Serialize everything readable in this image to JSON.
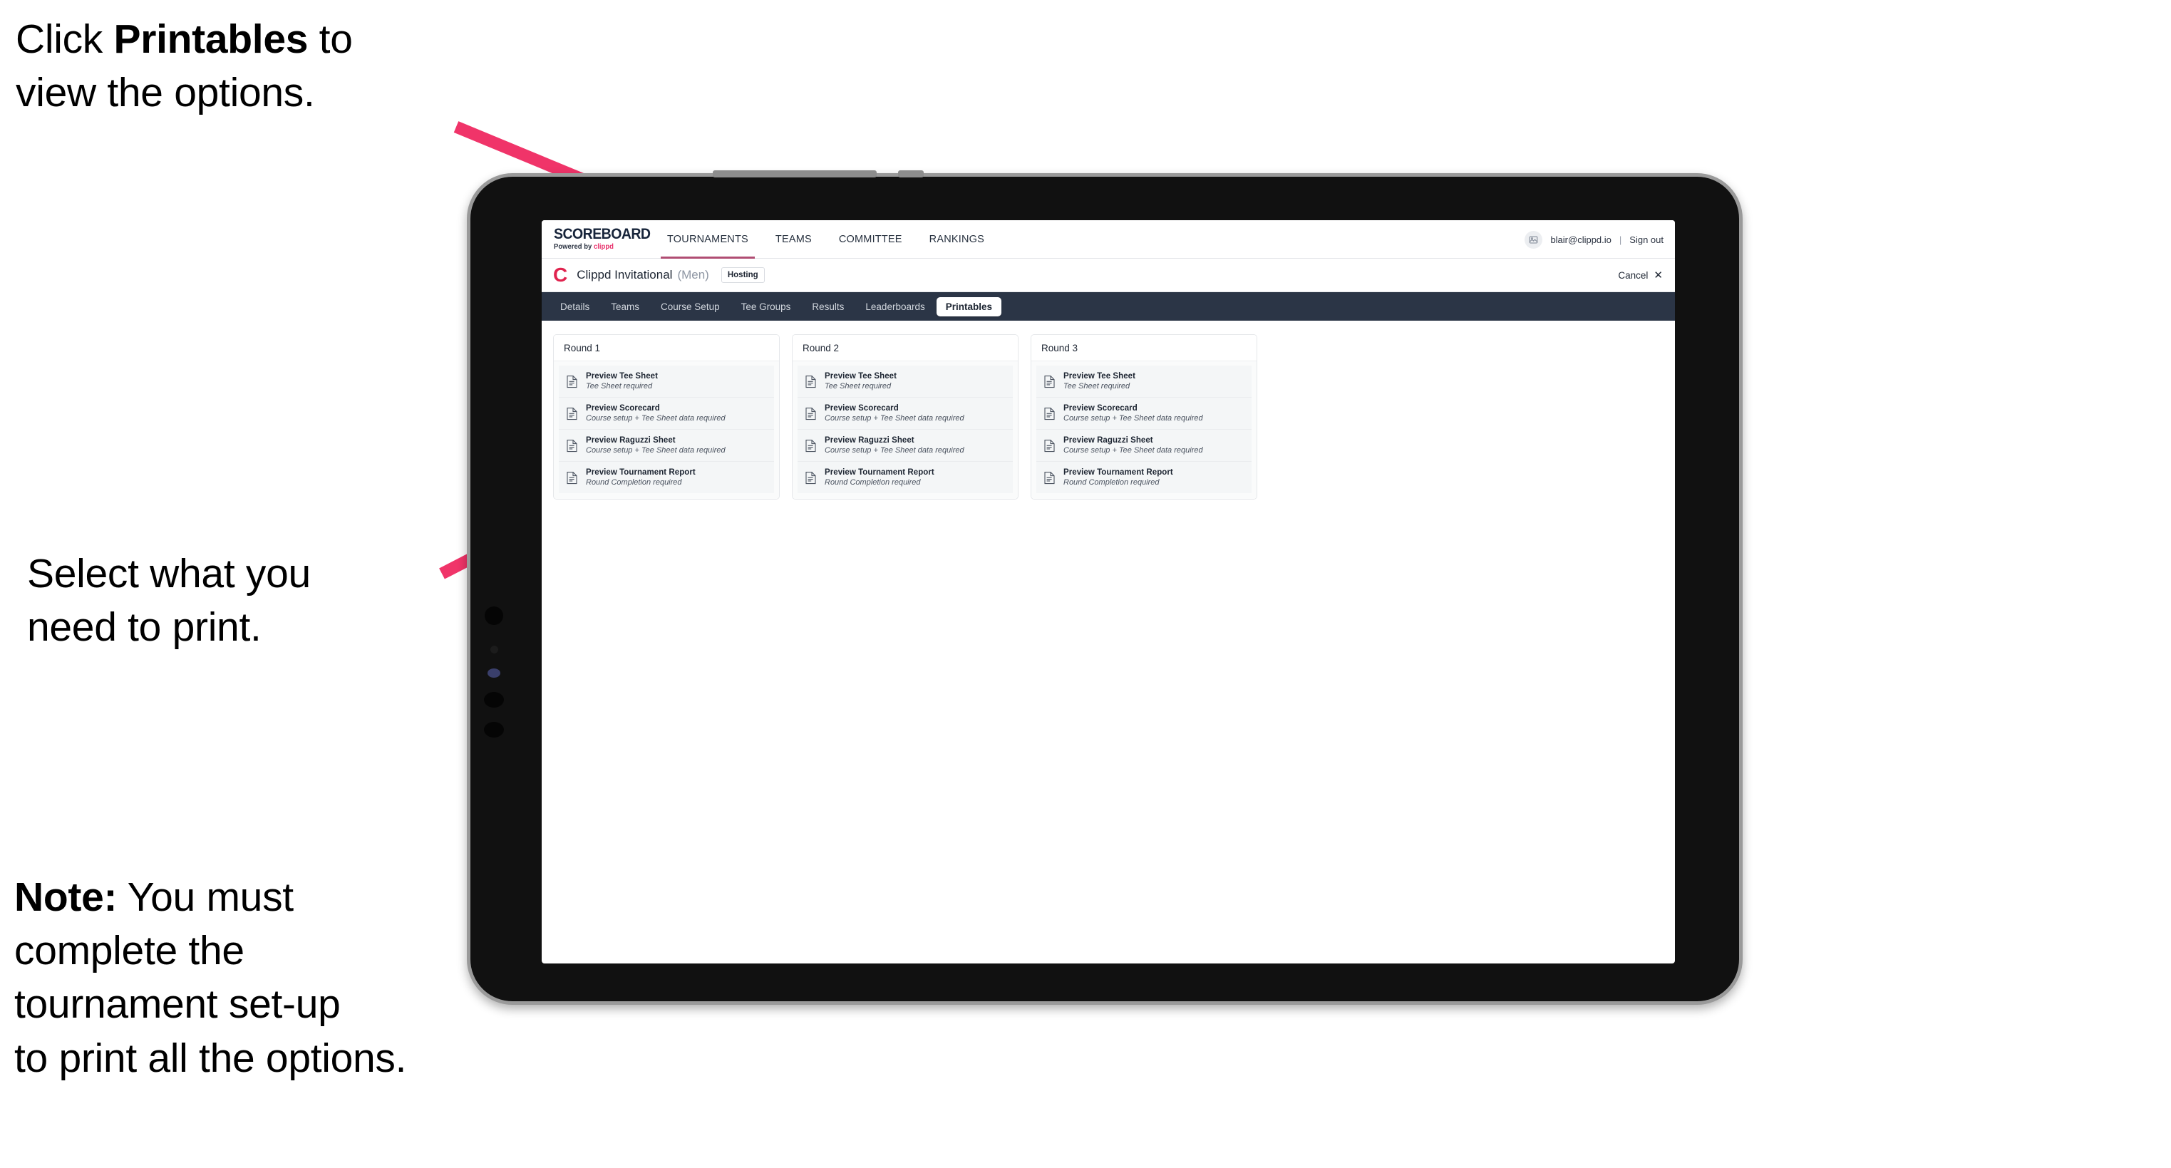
{
  "annotations": {
    "top": {
      "pre": "Click ",
      "bold": "Printables",
      "post": " to\nview the options."
    },
    "middle": "Select what you\n need to print.",
    "note": {
      "bold": "Note:",
      "text": " You must\ncomplete the\ntournament set-up\nto print all the options."
    }
  },
  "colors": {
    "arrow_pink": "#f03469",
    "brand_pink": "#e8336d",
    "tabstrip_navy": "#2b3546",
    "accent_underline": "#b04d73",
    "clippd_red": "#e0234e"
  },
  "app": {
    "brand": {
      "title": "SCOREBOARD",
      "sub_prefix": "Powered by ",
      "sub_brand": "clippd"
    },
    "topnav": [
      {
        "label": "TOURNAMENTS",
        "active": true
      },
      {
        "label": "TEAMS",
        "active": false
      },
      {
        "label": "COMMITTEE",
        "active": false
      },
      {
        "label": "RANKINGS",
        "active": false
      }
    ],
    "account": {
      "avatar_icon": "user-avatar-icon",
      "email": "blair@clippd.io",
      "separator": "|",
      "sign_out": "Sign out"
    },
    "tournament_bar": {
      "logo_letter": "C",
      "name": "Clippd Invitational",
      "gender": "(Men)",
      "badge": "Hosting",
      "cancel_label": "Cancel",
      "cancel_icon": "close-x-icon"
    },
    "tabs": [
      {
        "label": "Details",
        "selected": false
      },
      {
        "label": "Teams",
        "selected": false
      },
      {
        "label": "Course Setup",
        "selected": false
      },
      {
        "label": "Tee Groups",
        "selected": false
      },
      {
        "label": "Results",
        "selected": false
      },
      {
        "label": "Leaderboards",
        "selected": false
      },
      {
        "label": "Printables",
        "selected": true
      }
    ],
    "rounds": [
      {
        "title": "Round 1",
        "items": [
          {
            "icon": "document-icon",
            "title": "Preview Tee Sheet",
            "subtitle": "Tee Sheet required"
          },
          {
            "icon": "document-icon",
            "title": "Preview Scorecard",
            "subtitle": "Course setup + Tee Sheet data required"
          },
          {
            "icon": "document-icon",
            "title": "Preview Raguzzi Sheet",
            "subtitle": "Course setup + Tee Sheet data required"
          },
          {
            "icon": "document-icon",
            "title": "Preview Tournament Report",
            "subtitle": "Round Completion required"
          }
        ]
      },
      {
        "title": "Round 2",
        "items": [
          {
            "icon": "document-icon",
            "title": "Preview Tee Sheet",
            "subtitle": "Tee Sheet required"
          },
          {
            "icon": "document-icon",
            "title": "Preview Scorecard",
            "subtitle": "Course setup + Tee Sheet data required"
          },
          {
            "icon": "document-icon",
            "title": "Preview Raguzzi Sheet",
            "subtitle": "Course setup + Tee Sheet data required"
          },
          {
            "icon": "document-icon",
            "title": "Preview Tournament Report",
            "subtitle": "Round Completion required"
          }
        ]
      },
      {
        "title": "Round 3",
        "items": [
          {
            "icon": "document-icon",
            "title": "Preview Tee Sheet",
            "subtitle": "Tee Sheet required"
          },
          {
            "icon": "document-icon",
            "title": "Preview Scorecard",
            "subtitle": "Course setup + Tee Sheet data required"
          },
          {
            "icon": "document-icon",
            "title": "Preview Raguzzi Sheet",
            "subtitle": "Course setup + Tee Sheet data required"
          },
          {
            "icon": "document-icon",
            "title": "Preview Tournament Report",
            "subtitle": "Round Completion required"
          }
        ]
      }
    ]
  }
}
